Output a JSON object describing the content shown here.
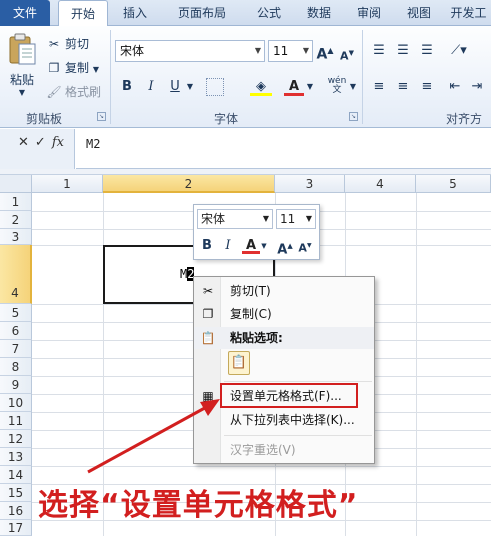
{
  "tabs": [
    "文件",
    "开始",
    "插入",
    "页面布局",
    "公式",
    "数据",
    "审阅",
    "视图",
    "开发工"
  ],
  "clipboard": {
    "paste_label": "粘贴",
    "cut_label": "剪切",
    "copy_label": "复制",
    "format_painter_label": "格式刷",
    "group_label": "剪贴板"
  },
  "font": {
    "font_name": "宋体",
    "font_size": "11",
    "bold": "B",
    "italic": "I",
    "underline": "U",
    "grow": "A",
    "shrink": "A",
    "font_color": "A",
    "wen": "wén",
    "group_label": "字体"
  },
  "alignment": {
    "group_label": "对齐方式"
  },
  "formula_bar": {
    "content": "M2"
  },
  "grid": {
    "columns": [
      "1",
      "2",
      "3",
      "4",
      "5"
    ],
    "rows": [
      "1",
      "2",
      "3",
      "4",
      "5",
      "6",
      "7",
      "8",
      "9",
      "10",
      "11",
      "12",
      "13",
      "14",
      "15",
      "16",
      "17"
    ],
    "active_cell_text": "M",
    "active_cell_caret": "2"
  },
  "minibar": {
    "font_name": "宋体",
    "font_size": "11",
    "bold": "B",
    "italic": "I",
    "font_color": "A",
    "grow": "A",
    "shrink": "A"
  },
  "context_menu": {
    "cut": "剪切(T)",
    "copy": "复制(C)",
    "paste_options": "粘贴选项:",
    "format_cells": "设置单元格格式(F)...",
    "pick_from_list": "从下拉列表中选择(K)...",
    "hanzi_reselect": "汉字重选(V)"
  },
  "annotation": {
    "text": "选择“设置单元格格式”"
  },
  "colors": {
    "accent": "#2a5ea4",
    "annotation": "#d21f1f",
    "selection": "#f5d37a"
  }
}
